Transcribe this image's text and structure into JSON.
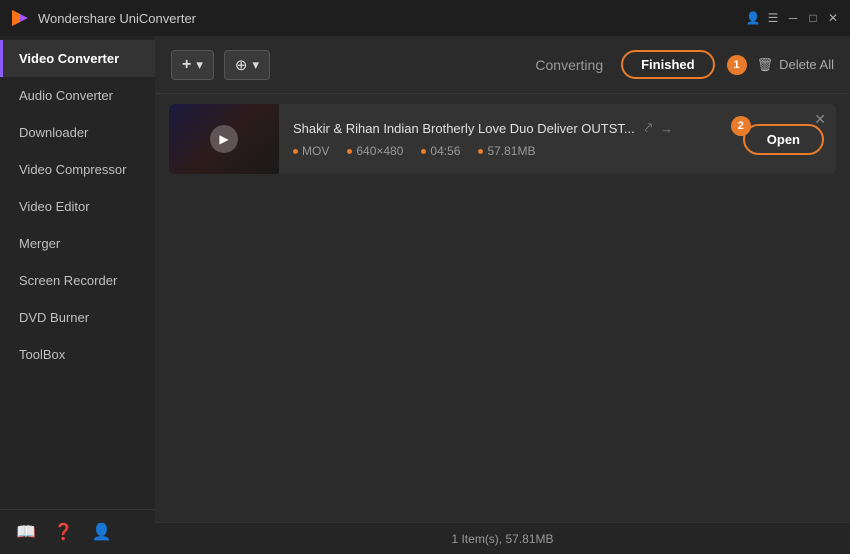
{
  "app": {
    "title": "Wondershare UniConverter",
    "logo_symbol": "▶"
  },
  "titlebar": {
    "account_icon": "👤",
    "menu_icon": "☰",
    "minimize_icon": "─",
    "maximize_icon": "□",
    "close_icon": "✕"
  },
  "sidebar": {
    "items": [
      {
        "id": "video-converter",
        "label": "Video Converter",
        "active": true
      },
      {
        "id": "audio-converter",
        "label": "Audio Converter",
        "active": false
      },
      {
        "id": "downloader",
        "label": "Downloader",
        "active": false
      },
      {
        "id": "video-compressor",
        "label": "Video Compressor",
        "active": false
      },
      {
        "id": "video-editor",
        "label": "Video Editor",
        "active": false
      },
      {
        "id": "merger",
        "label": "Merger",
        "active": false
      },
      {
        "id": "screen-recorder",
        "label": "Screen Recorder",
        "active": false
      },
      {
        "id": "dvd-burner",
        "label": "DVD Burner",
        "active": false
      },
      {
        "id": "toolbox",
        "label": "ToolBox",
        "active": false
      }
    ],
    "footer_icons": [
      "📖",
      "❓",
      "👤"
    ]
  },
  "toolbar": {
    "add_files_label": "＋",
    "add_dropdown_icon": "▾",
    "settings_icon": "⊕",
    "tab_converting": "Converting",
    "tab_finished": "Finished",
    "finished_badge": "1",
    "delete_icon": "🗑",
    "delete_all_label": "Delete All"
  },
  "files": [
    {
      "id": "file-1",
      "name": "Shakir & Rihan Indian Brotherly Love Duo Deliver OUTST...",
      "format": "MOV",
      "resolution": "640×480",
      "duration": "04:56",
      "size": "57.81MB",
      "open_label": "Open",
      "badge": "2",
      "close_icon": "✕",
      "external_icon": "⤤",
      "arrow_icon": "→"
    }
  ],
  "statusbar": {
    "text": "1 Item(s), 57.81MB"
  }
}
